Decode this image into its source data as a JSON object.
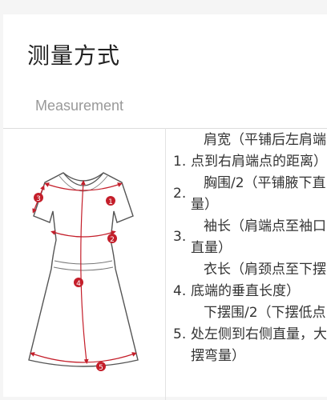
{
  "header": {
    "title": "测量方式",
    "subtitle": "Measurement"
  },
  "colors": {
    "accent": "#c41e2a",
    "outline": "#555555"
  },
  "dress_markers": [
    "1",
    "2",
    "3",
    "4",
    "5"
  ],
  "steps": [
    {
      "num": "1.",
      "text": "肩宽（平铺后左肩端点到右肩端点的距离）"
    },
    {
      "num": "2.",
      "text": "胸围/2（平铺腋下直量）"
    },
    {
      "num": "3.",
      "text": "袖长（肩端点至袖口直量）"
    },
    {
      "num": "4.",
      "text": "衣长（肩颈点至下摆底端的垂直长度）"
    },
    {
      "num": "5.",
      "text": "下摆围/2（下摆低点处左侧到右侧直量，大摆弯量）"
    }
  ]
}
